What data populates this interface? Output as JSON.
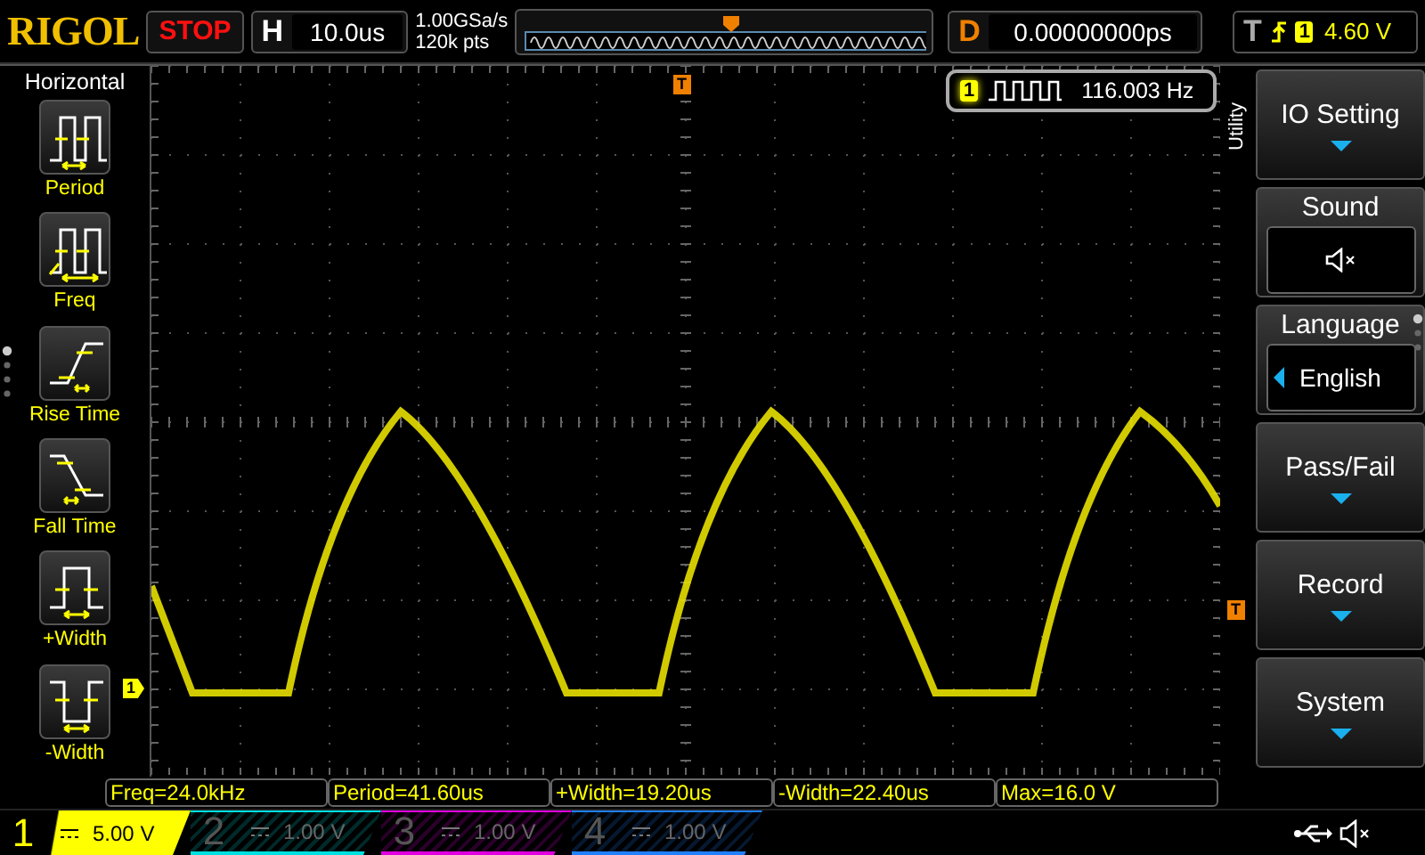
{
  "brand": "RIGOL",
  "run_state": "STOP",
  "horizontal": {
    "label": "H",
    "timebase": "10.0us"
  },
  "acquisition": {
    "sample_rate": "1.00GSa/s",
    "memory_depth": "120k pts"
  },
  "delay": {
    "label": "D",
    "value": "0.00000000ps"
  },
  "trigger": {
    "label": "T",
    "channel": "1",
    "level": "4.60 V"
  },
  "frequency_counter": {
    "channel": "1",
    "value": "116.003 Hz"
  },
  "markers": {
    "trigger_position": "T",
    "trigger_level": "T",
    "channel": "1"
  },
  "left_menu": {
    "title": "Horizontal",
    "items": [
      {
        "label": "Period",
        "kind": "period"
      },
      {
        "label": "Freq",
        "kind": "freq"
      },
      {
        "label": "Rise Time",
        "kind": "rise"
      },
      {
        "label": "Fall Time",
        "kind": "fall"
      },
      {
        "label": "+Width",
        "kind": "pwidth"
      },
      {
        "label": "-Width",
        "kind": "nwidth"
      }
    ]
  },
  "right_menu": {
    "title": "Utility",
    "items": [
      {
        "label": "IO Setting",
        "kind": "submenu"
      },
      {
        "label": "Sound",
        "kind": "mute"
      },
      {
        "label": "Language",
        "kind": "choice",
        "value": "English"
      },
      {
        "label": "Pass/Fail",
        "kind": "submenu"
      },
      {
        "label": "Record",
        "kind": "submenu"
      },
      {
        "label": "System",
        "kind": "submenu"
      }
    ]
  },
  "measurements": [
    "Freq=24.0kHz",
    "Period=41.60us",
    "+Width=19.20us",
    "-Width=22.40us",
    "Max=16.0 V"
  ],
  "channels": [
    {
      "number": "1",
      "scale": "5.00 V",
      "on": true,
      "color": "#ffff00"
    },
    {
      "number": "2",
      "scale": "1.00 V",
      "on": false,
      "color": "#00e0e0"
    },
    {
      "number": "3",
      "scale": "1.00 V",
      "on": false,
      "color": "#e000e0"
    },
    {
      "number": "4",
      "scale": "1.00 V",
      "on": false,
      "color": "#2080ff"
    }
  ]
}
